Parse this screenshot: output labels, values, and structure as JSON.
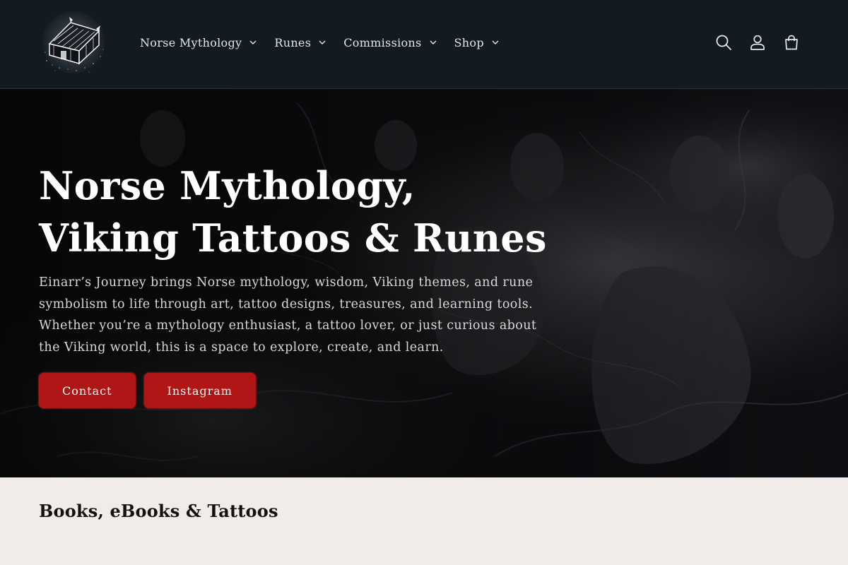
{
  "header": {
    "logo_alt": "Einarr's Journey longhouse logo",
    "nav": [
      {
        "label": "Norse Mythology"
      },
      {
        "label": "Runes"
      },
      {
        "label": "Commissions"
      },
      {
        "label": "Shop"
      }
    ],
    "icons": [
      "search-icon",
      "account-icon",
      "cart-icon"
    ]
  },
  "hero": {
    "title": "Norse Mythology, Viking Tattoos & Runes",
    "text": "Einarr’s Journey brings Norse mythology, wisdom, Viking themes, and rune symbolism to life through art, tattoo designs, treasures, and learning tools. Whether you’re a mythology enthusiast, a tattoo lover, or just curious about the Viking world, this is a space to explore, create, and learn.",
    "buttons": [
      {
        "label": "Contact"
      },
      {
        "label": "Instagram"
      }
    ]
  },
  "section": {
    "title": "Books, eBooks & Tattoos"
  },
  "colors": {
    "header_bg": "#121a22",
    "hero_bg": "#0a0b0d",
    "button_red": "#b11616",
    "section_bg": "#f1ebea"
  }
}
